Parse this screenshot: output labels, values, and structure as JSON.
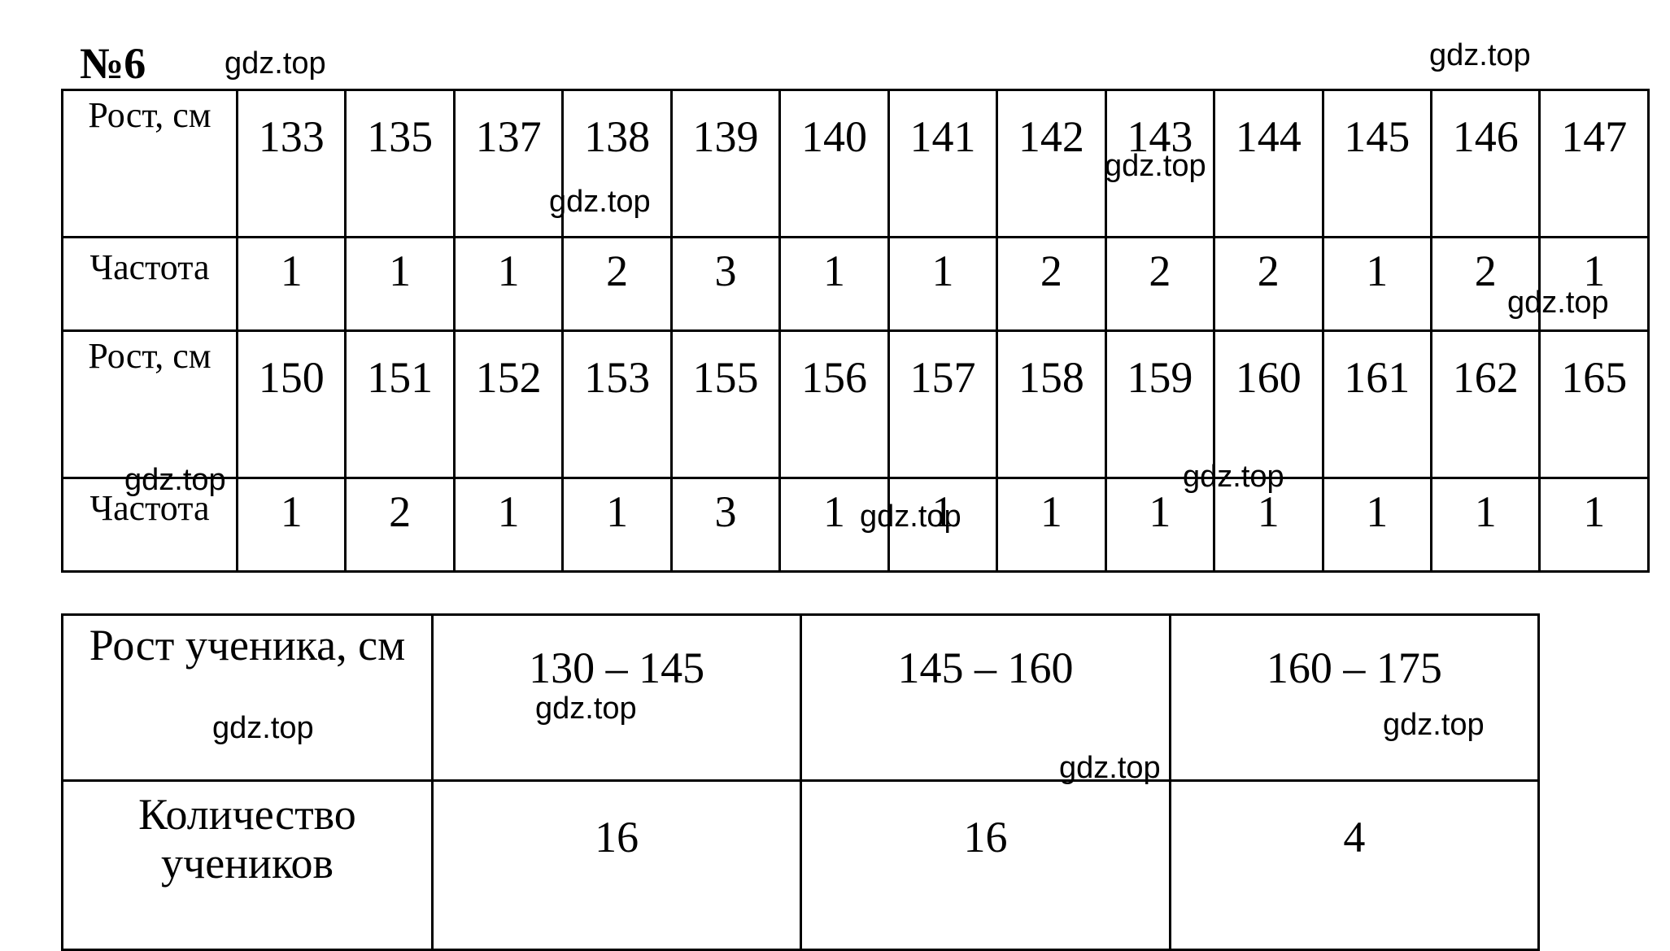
{
  "title": "№6",
  "table1": {
    "rows": [
      {
        "label": "Рост, см",
        "values": [
          "133",
          "135",
          "137",
          "138",
          "139",
          "140",
          "141",
          "142",
          "143",
          "144",
          "145",
          "146",
          "147"
        ]
      },
      {
        "label": "Частота",
        "values": [
          "1",
          "1",
          "1",
          "2",
          "3",
          "1",
          "1",
          "2",
          "2",
          "2",
          "1",
          "2",
          "1"
        ]
      },
      {
        "label": "Рост, см",
        "values": [
          "150",
          "151",
          "152",
          "153",
          "155",
          "156",
          "157",
          "158",
          "159",
          "160",
          "161",
          "162",
          "165"
        ]
      },
      {
        "label": "Частота",
        "values": [
          "1",
          "2",
          "1",
          "1",
          "3",
          "1",
          "1",
          "1",
          "1",
          "1",
          "1",
          "1",
          "1"
        ]
      }
    ]
  },
  "table2": {
    "header_label": "Рост ученика, см",
    "intervals": [
      "130 – 145",
      "145 – 160",
      "160 – 175"
    ],
    "count_label": "Количество учеников",
    "counts": [
      "16",
      "16",
      "4"
    ]
  },
  "watermark": "gdz.top"
}
